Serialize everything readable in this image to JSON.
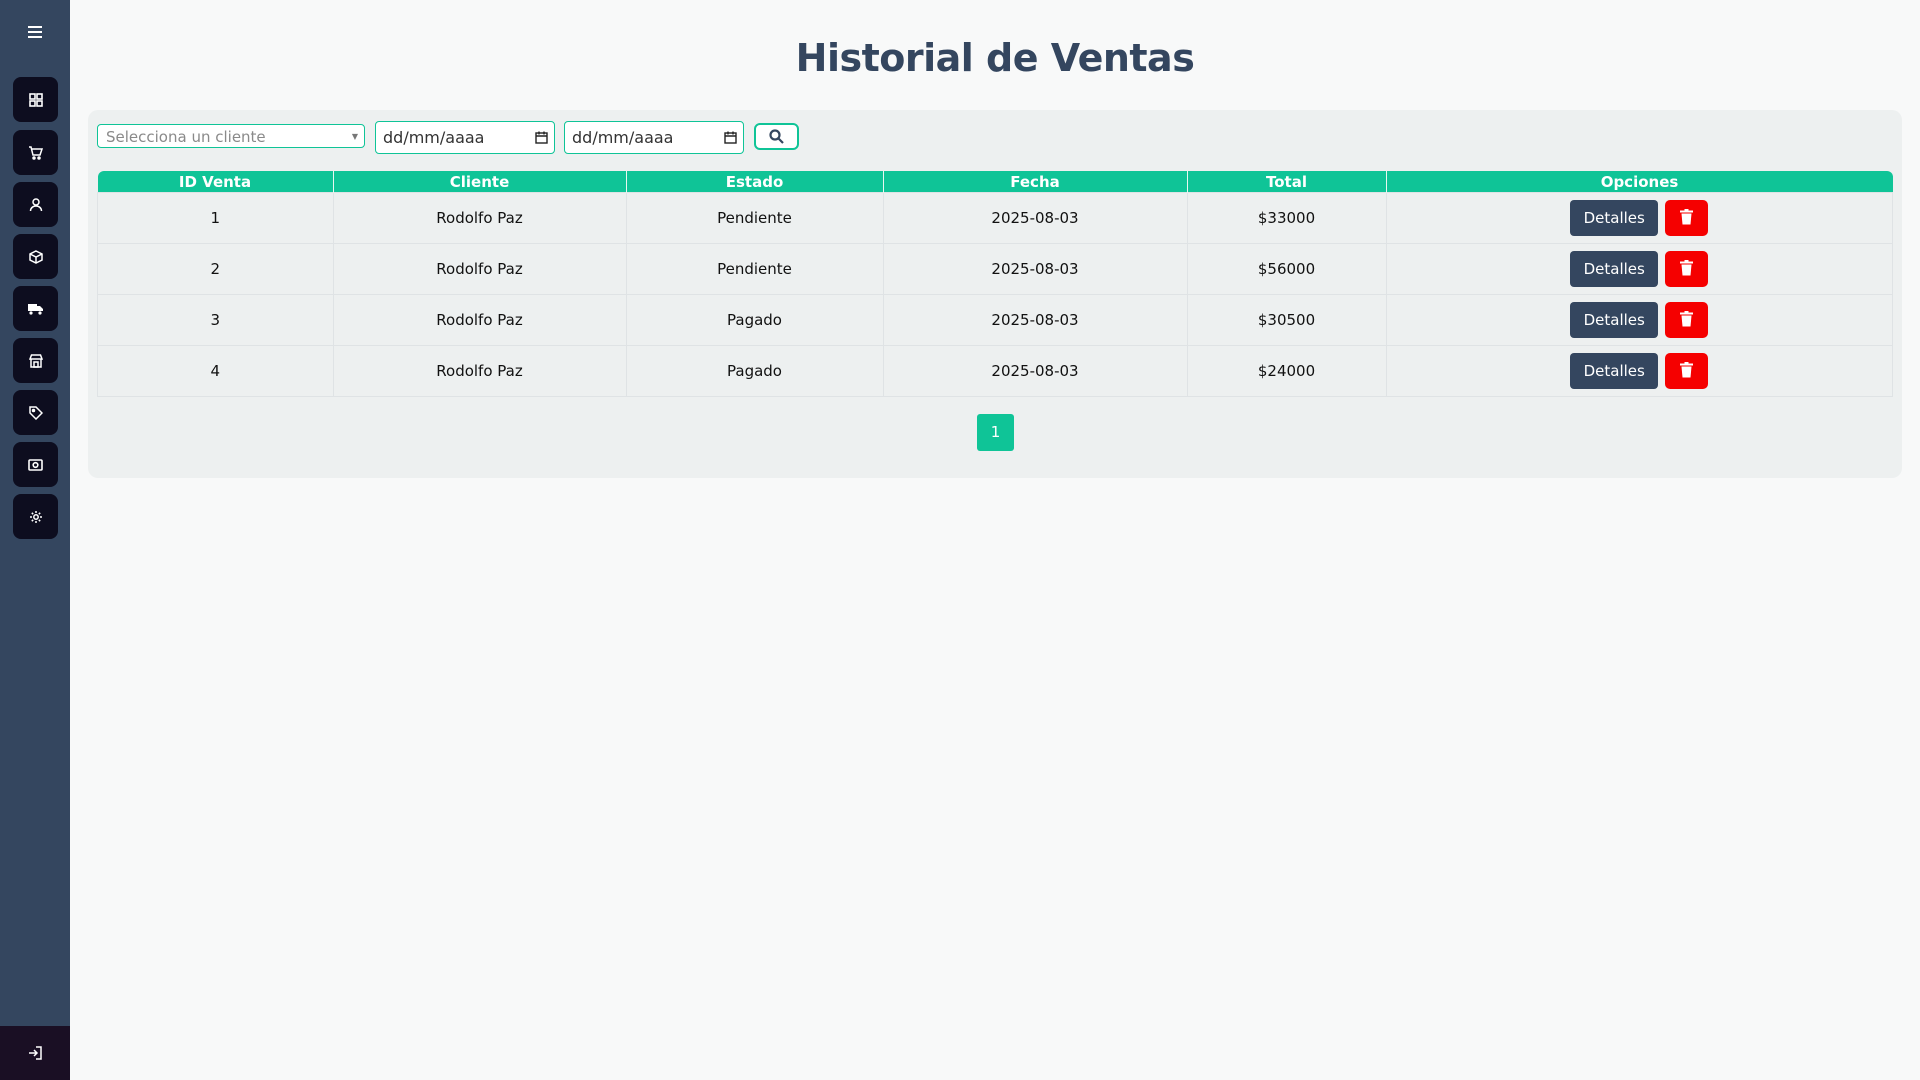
{
  "page": {
    "title": "Historial de Ventas"
  },
  "sidebar": {
    "menu_icon": "hamburger-icon",
    "items": [
      {
        "icon": "dashboard-grid-icon"
      },
      {
        "icon": "cart-icon"
      },
      {
        "icon": "user-icon"
      },
      {
        "icon": "box-icon"
      },
      {
        "icon": "truck-icon"
      },
      {
        "icon": "store-icon"
      },
      {
        "icon": "tag-icon"
      },
      {
        "icon": "cash-icon"
      },
      {
        "icon": "gear-icon"
      }
    ],
    "logout_icon": "logout-icon"
  },
  "filters": {
    "client_placeholder": "Selecciona un cliente",
    "date_from_placeholder": "dd/mm/aaaa",
    "date_to_placeholder": "dd/mm/aaaa",
    "search_icon": "search-icon"
  },
  "table": {
    "headers": [
      "ID Venta",
      "Cliente",
      "Estado",
      "Fecha",
      "Total",
      "Opciones"
    ],
    "rows": [
      {
        "id": "1",
        "cliente": "Rodolfo Paz",
        "estado": "Pendiente",
        "fecha": "2025-08-03",
        "total": "$33000"
      },
      {
        "id": "2",
        "cliente": "Rodolfo Paz",
        "estado": "Pendiente",
        "fecha": "2025-08-03",
        "total": "$56000"
      },
      {
        "id": "3",
        "cliente": "Rodolfo Paz",
        "estado": "Pagado",
        "fecha": "2025-08-03",
        "total": "$30500"
      },
      {
        "id": "4",
        "cliente": "Rodolfo Paz",
        "estado": "Pagado",
        "fecha": "2025-08-03",
        "total": "$24000"
      }
    ],
    "details_label": "Detalles",
    "delete_icon": "trash-icon"
  },
  "pagination": {
    "current_page": "1"
  },
  "colors": {
    "sidebar_bg": "#34465f",
    "accent": "#0fc497",
    "title": "#34465f",
    "details_button": "#34465f",
    "delete_button": "#f50000"
  }
}
